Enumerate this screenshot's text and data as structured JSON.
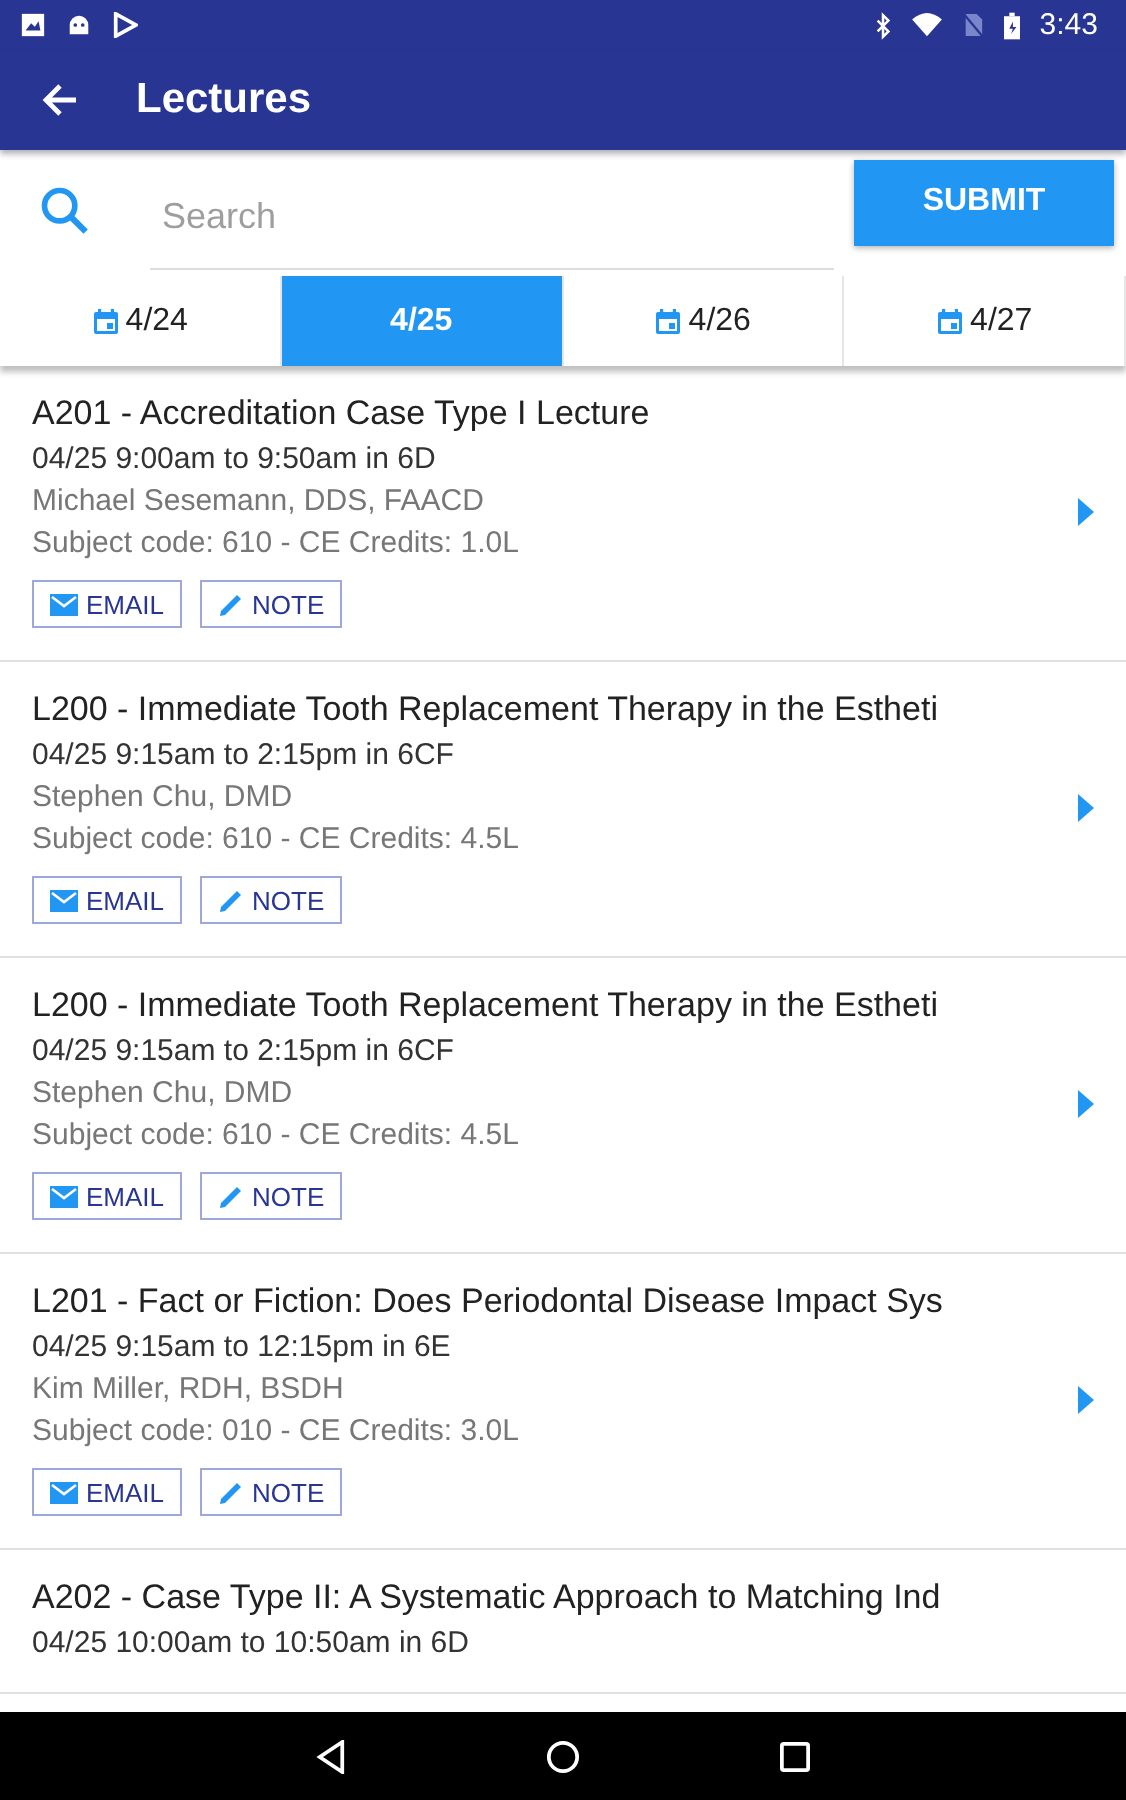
{
  "status_bar": {
    "time": "3:43"
  },
  "app_bar": {
    "title": "Lectures"
  },
  "search": {
    "placeholder": "Search",
    "button": "SUBMIT"
  },
  "tabs": [
    {
      "label": "4/24",
      "selected": false
    },
    {
      "label": "4/25",
      "selected": true
    },
    {
      "label": "4/26",
      "selected": false
    },
    {
      "label": "4/27",
      "selected": false
    }
  ],
  "lectures": [
    {
      "title": "A201 - Accreditation Case Type I Lecture",
      "time": "04/25 9:00am to 9:50am in 6D",
      "speaker": "Michael Sesemann, DDS, FAACD",
      "subject": "Subject code: 610 - CE Credits: 1.0L",
      "buttons": [
        "EMAIL",
        "NOTE"
      ]
    },
    {
      "title": "L200 - Immediate Tooth Replacement Therapy in the Estheti",
      "time": "04/25 9:15am to 2:15pm in 6CF",
      "speaker": "Stephen Chu, DMD",
      "subject": "Subject code: 610 - CE Credits: 4.5L",
      "buttons": [
        "EMAIL",
        "NOTE"
      ]
    },
    {
      "title": "L200 - Immediate Tooth Replacement Therapy in the Estheti",
      "time": "04/25 9:15am to 2:15pm in 6CF",
      "speaker": "Stephen Chu, DMD",
      "subject": "Subject code: 610 - CE Credits: 4.5L",
      "buttons": [
        "EMAIL",
        "NOTE"
      ]
    },
    {
      "title": "L201 - Fact or Fiction: Does Periodontal Disease Impact Sys",
      "time": "04/25 9:15am to 12:15pm in 6E",
      "speaker": "Kim Miller, RDH, BSDH",
      "subject": "Subject code: 010 - CE Credits: 3.0L",
      "buttons": [
        "EMAIL",
        "NOTE"
      ]
    },
    {
      "title": "A202 - Case Type II: A Systematic Approach to Matching Ind",
      "time": "04/25 10:00am to 10:50am in 6D"
    }
  ]
}
